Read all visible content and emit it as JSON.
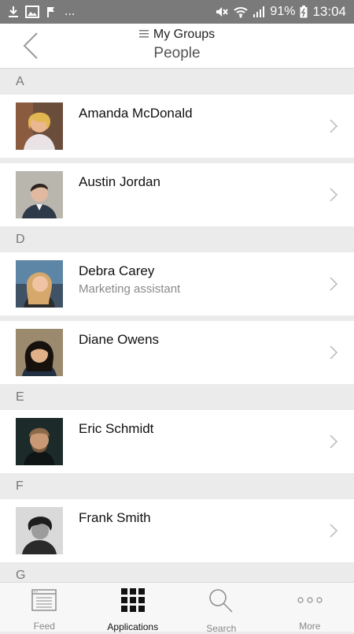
{
  "status_bar": {
    "dots": "...",
    "battery_percent": "91%",
    "time": "13:04"
  },
  "header": {
    "group_title": "My Groups",
    "page_title": "People"
  },
  "sections": [
    {
      "letter": "A",
      "people": [
        {
          "name": "Amanda McDonald",
          "subtitle": ""
        },
        {
          "name": "Austin Jordan",
          "subtitle": ""
        }
      ]
    },
    {
      "letter": "D",
      "people": [
        {
          "name": "Debra Carey",
          "subtitle": "Marketing assistant"
        },
        {
          "name": "Diane Owens",
          "subtitle": ""
        }
      ]
    },
    {
      "letter": "E",
      "people": [
        {
          "name": "Eric Schmidt",
          "subtitle": ""
        }
      ]
    },
    {
      "letter": "F",
      "people": [
        {
          "name": "Frank Smith",
          "subtitle": ""
        }
      ]
    },
    {
      "letter": "G",
      "people": []
    }
  ],
  "bottom_nav": [
    {
      "label": "Feed",
      "icon": "feed-icon",
      "active": false
    },
    {
      "label": "Applications",
      "icon": "applications-grid-icon",
      "active": true
    },
    {
      "label": "Search",
      "icon": "search-icon",
      "active": false
    },
    {
      "label": "More",
      "icon": "more-dots-icon",
      "active": false
    }
  ],
  "colors": {
    "status_bar": "#7a7a7a",
    "section_bg": "#ebebeb",
    "row_bg": "#ffffff",
    "subtitle_text": "#8a8a8a",
    "active_nav": "#111111",
    "inactive_nav": "#888888"
  }
}
